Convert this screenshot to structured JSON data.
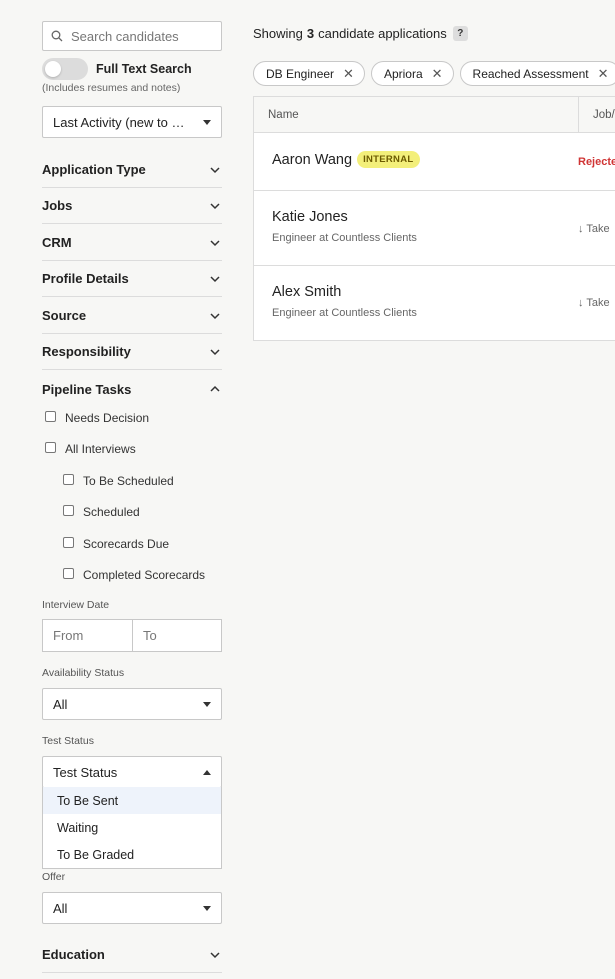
{
  "sidebar": {
    "search_placeholder": "Search candidates",
    "full_text_search_label": "Full Text Search",
    "full_text_search_note": "(Includes resumes and notes)",
    "sort_select": "Last Activity (new to …",
    "sections": [
      {
        "title": "Application Type"
      },
      {
        "title": "Jobs"
      },
      {
        "title": "CRM"
      },
      {
        "title": "Profile Details"
      },
      {
        "title": "Source"
      },
      {
        "title": "Responsibility"
      },
      {
        "title": "Pipeline Tasks"
      }
    ],
    "pipeline_tasks": {
      "needs_decision": "Needs Decision",
      "all_interviews": "All Interviews",
      "to_be_scheduled": "To Be Scheduled",
      "scheduled": "Scheduled",
      "scorecards_due": "Scorecards Due",
      "completed_scorecards": "Completed Scorecards"
    },
    "interview_date_label": "Interview Date",
    "date_from": "From",
    "date_to": "To",
    "availability_label": "Availability Status",
    "availability_value": "All",
    "test_status_label": "Test Status",
    "test_status_value": "Test Status",
    "test_status_options": [
      "To Be Sent",
      "Waiting",
      "To Be Graded"
    ],
    "offer_label": "Offer",
    "offer_value": "All",
    "education_title": "Education"
  },
  "main": {
    "showing_prefix": "Showing",
    "showing_count": "3",
    "showing_suffix": "candidate applications",
    "help_glyph": "?",
    "chips": [
      "DB Engineer",
      "Apriora",
      "Reached Assessment"
    ],
    "columns": {
      "name": "Name",
      "job": "Job/"
    },
    "rows": [
      {
        "name": "Aaron Wang",
        "badge": "INTERNAL",
        "subtitle": "",
        "status": "Rejecte"
      },
      {
        "name": "Katie Jones",
        "badge": "",
        "subtitle": "Engineer at Countless Clients",
        "status": "↓ Take"
      },
      {
        "name": "Alex Smith",
        "badge": "",
        "subtitle": "Engineer at Countless Clients",
        "status": "↓ Take"
      }
    ]
  },
  "icons": {
    "search": "search-icon",
    "chevron_down": "chevron-down-icon",
    "chevron_up": "chevron-up-icon",
    "remove": "close-icon"
  },
  "colors": {
    "badge_bg": "#f3ef7a",
    "rejected": "#d03535",
    "option_highlight": "#eef3fb"
  }
}
